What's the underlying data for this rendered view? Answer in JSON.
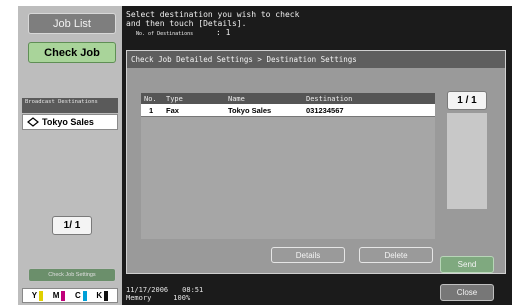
{
  "left": {
    "job_list": "Job List",
    "check_job": "Check Job",
    "broadcast_header": "Broadcast Destinations",
    "broadcast_item": "Tokyo Sales",
    "page_indicator": "1/ 1",
    "check_job_settings": "Check Job Settings",
    "toners": [
      "Y",
      "M",
      "C",
      "K"
    ]
  },
  "message": {
    "line1": "Select destination you wish to check",
    "line2": "and then touch [Details].",
    "count_label": "No. of Destinations",
    "count_value": ": 1"
  },
  "panel": {
    "title": "Check Job Detailed Settings > Destination Settings",
    "columns": [
      "No.",
      "Type",
      "Name",
      "Destination"
    ],
    "rows": [
      {
        "no": "1",
        "type": "Fax",
        "name": "Tokyo Sales",
        "destination": "031234567"
      }
    ],
    "page_indicator": "1 / 1",
    "details": "Details",
    "delete": "Delete"
  },
  "actions": {
    "send": "Send",
    "close": "Close"
  },
  "status": {
    "date": "11/17/2006",
    "time": "08:51",
    "memory_label": "Memory",
    "memory_value": "100%"
  },
  "colors": {
    "accent_green": "#a9d49a",
    "toner_yellow": "#e0d000",
    "toner_magenta": "#c0007a",
    "toner_cyan": "#00a0d8",
    "toner_black": "#111111"
  }
}
